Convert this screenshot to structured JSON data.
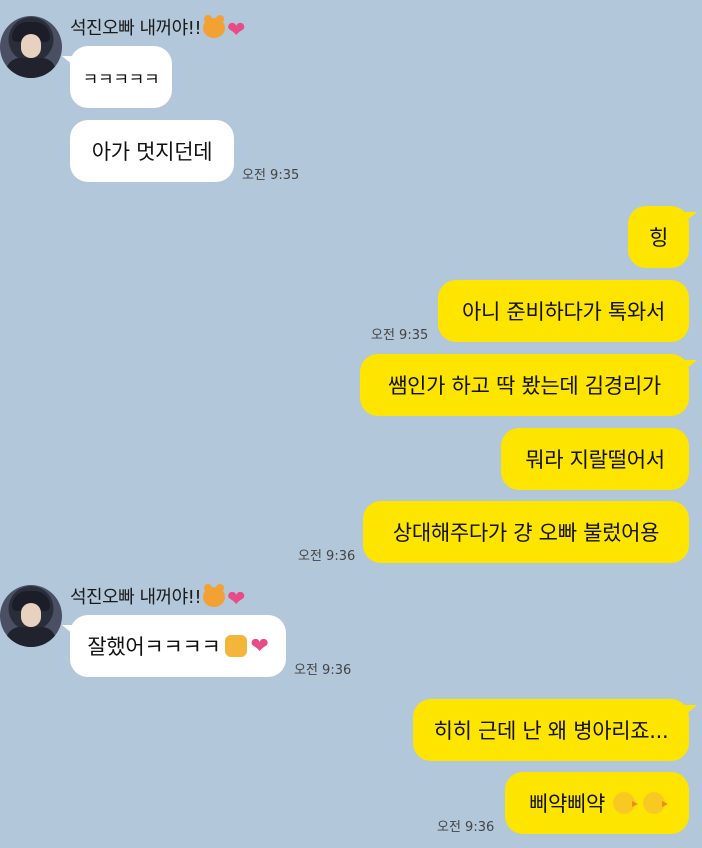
{
  "group1": {
    "sender": "석진오빠 내꺼야!!",
    "messages": [
      "ㅋㅋㅋㅋㅋ",
      "아가 멋지던데"
    ],
    "time": "오전 9:35"
  },
  "mine1": {
    "messages": [
      "힝",
      "아니 준비하다가 톡와서"
    ],
    "time": "오전 9:35"
  },
  "mine2": {
    "messages": [
      "쌤인가 하고 딱 봤는데 김경리가",
      "뭐라 지랄떨어서",
      "상대해주다가 걍 오빠 불렀어용"
    ],
    "time": "오전 9:36"
  },
  "group2": {
    "sender": "석진오빠 내꺼야!!",
    "message": "잘했어ㅋㅋㅋㅋ",
    "time": "오전 9:36"
  },
  "mine3": {
    "messages": [
      "히히 근데 난 왜 병아리죠...",
      "삐약삐약"
    ],
    "time": "오전 9:36"
  },
  "icons": [
    "hamster-emoji",
    "heart-emoji",
    "thumbs-up-emoji",
    "chick-emoji"
  ],
  "colors": {
    "background": "#b2c7da",
    "incoming": "#ffffff",
    "outgoing": "#fee500"
  }
}
